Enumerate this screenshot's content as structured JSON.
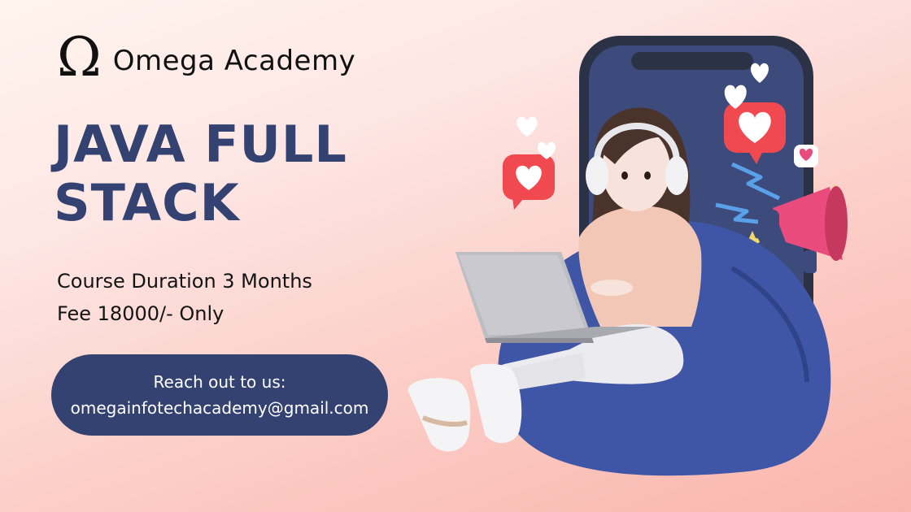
{
  "logo": {
    "symbol": "Ω",
    "name": "Omega Academy"
  },
  "headline": {
    "line1": "JAVA FULL",
    "line2": "STACK"
  },
  "details": {
    "duration": "Course Duration 3 Months",
    "fee": "Fee 18000/- Only"
  },
  "contact": {
    "label": "Reach out to us:",
    "email": "omegainfotechacademy@gmail.com"
  },
  "colors": {
    "primary": "#344272",
    "accent_red": "#f0494f",
    "background": "#fde6e4"
  },
  "illustration": {
    "icons": [
      "phone",
      "woman-with-laptop",
      "beanbag",
      "heart-bubble",
      "megaphone",
      "lightning",
      "star"
    ]
  }
}
